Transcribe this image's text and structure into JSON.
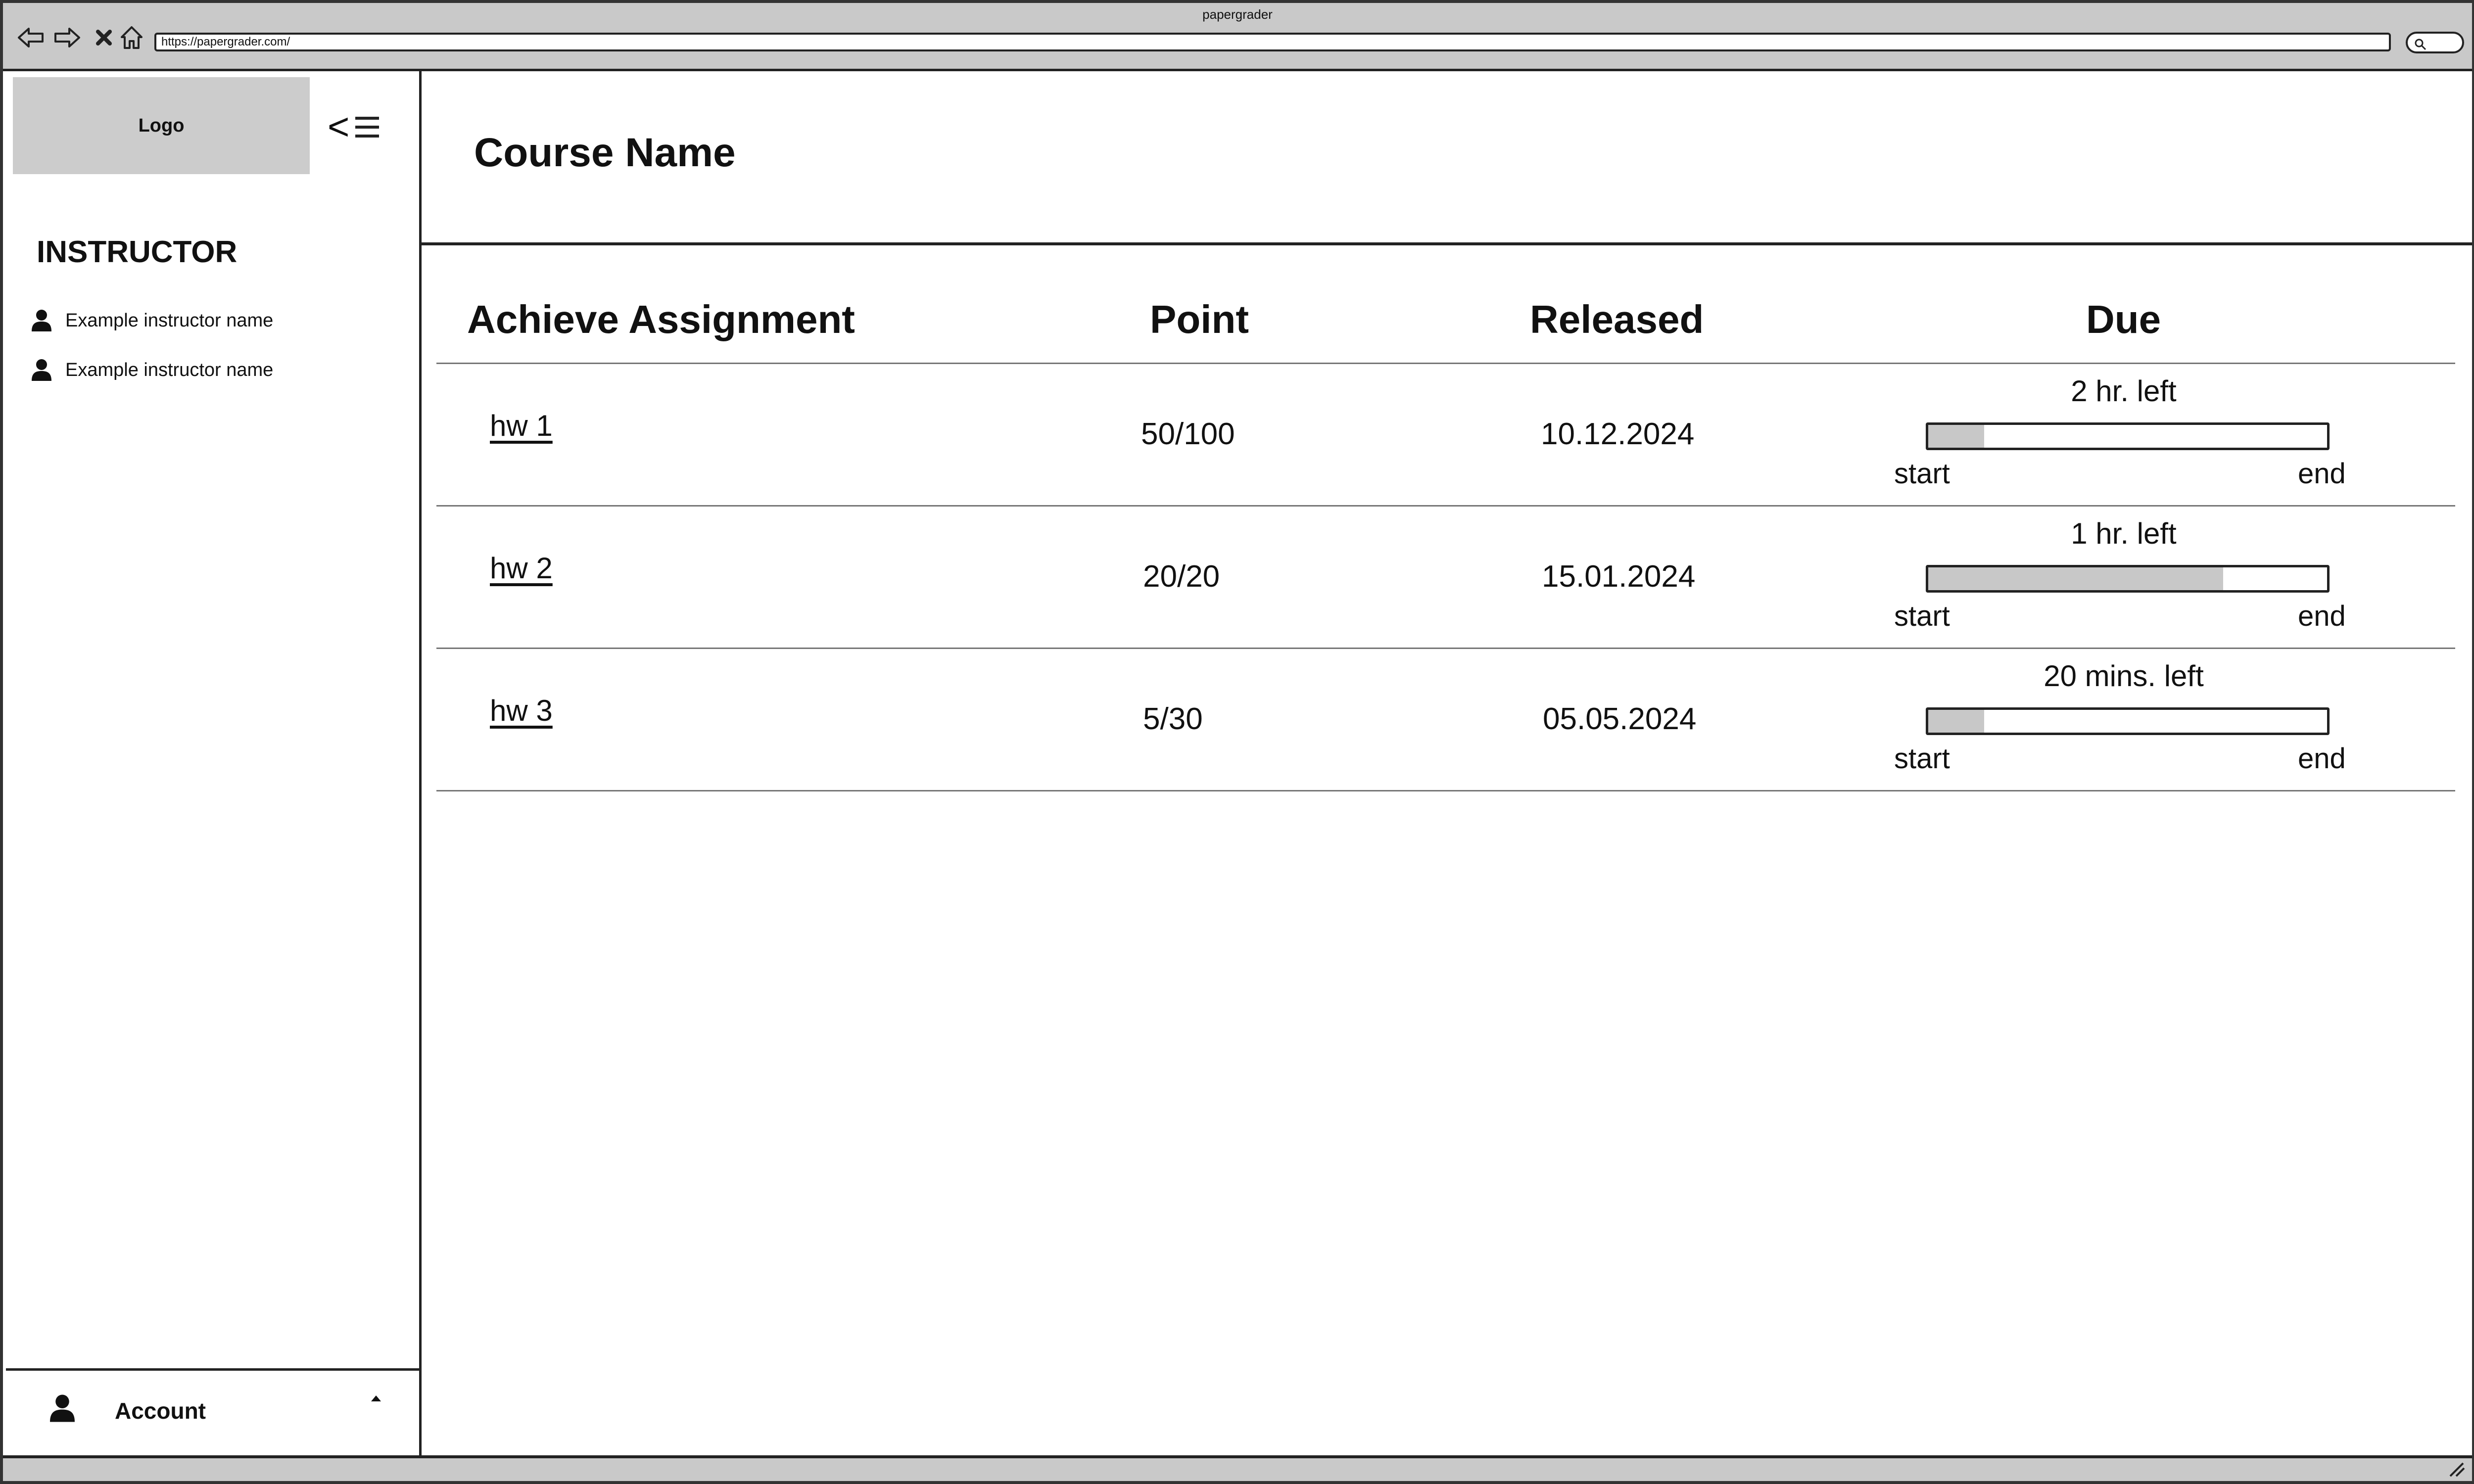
{
  "browser": {
    "window_title": "papergrader",
    "url": "https://papergrader.com/",
    "nav_icons": [
      "back-arrow-icon",
      "forward-arrow-icon",
      "close-x-icon",
      "home-icon"
    ]
  },
  "sidebar": {
    "logo_text": "Logo",
    "toggle_chevron": "<",
    "instructor_heading": "INSTRUCTOR",
    "instructors": [
      {
        "name": "Example instructor name"
      },
      {
        "name": "Example instructor name"
      }
    ],
    "account_label": "Account"
  },
  "main": {
    "course_title": "Course Name",
    "columns": [
      "Achieve Assignment",
      "Point",
      "Released",
      "Due"
    ],
    "assignments": [
      {
        "name": "hw 1",
        "points": "50/100",
        "released": "10.12.2024",
        "time_left": "2 hr. left",
        "progress_pct": 14,
        "start_label": "start",
        "end_label": "end"
      },
      {
        "name": "hw 2",
        "points": "20/20",
        "released": "15.01.2024",
        "time_left": "1 hr. left",
        "progress_pct": 74,
        "start_label": "start",
        "end_label": "end"
      },
      {
        "name": "hw 3",
        "points": "5/30",
        "released": "05.05.2024",
        "time_left": "20 mins. left",
        "progress_pct": 14,
        "start_label": "start",
        "end_label": "end"
      }
    ]
  },
  "colors": {
    "chrome_gray": "#c9c9c9",
    "logo_gray": "#cccccc",
    "progress_fill": "#c8c8c8",
    "border": "#222222"
  }
}
